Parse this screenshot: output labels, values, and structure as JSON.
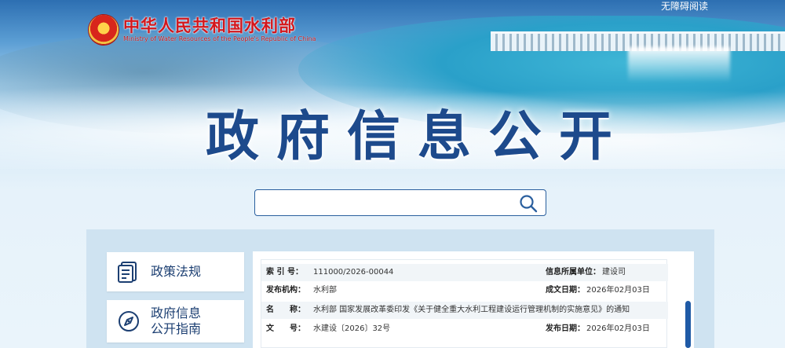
{
  "header": {
    "accessible_label": "无障碍阅读",
    "logo_cn": "中华人民共和国水利部",
    "logo_en": "Ministry of Water Resources of the People's Republic of China",
    "title": "政府信息公开"
  },
  "search": {
    "value": "",
    "placeholder": ""
  },
  "sidebar": {
    "items": [
      {
        "label": "政策法规",
        "icon": "policy-document-icon"
      },
      {
        "label_line1": "政府信息",
        "label_line2": "公开指南",
        "icon": "compass-icon"
      }
    ]
  },
  "info": {
    "index_label": "索 引 号：",
    "index_value": "111000/2026-00044",
    "unit_label": "信息所属单位：",
    "unit_value": "建设司",
    "issuer_label": "发布机构：",
    "issuer_value": "水利部",
    "created_label": "成文日期：",
    "created_value": "2026年02月03日",
    "name_label": "名　　称：",
    "name_value": "水利部 国家发展改革委印发《关于健全重大水利工程建设运行管理机制的实施意见》的通知",
    "doc_label": "文　　号：",
    "doc_value": "水建设〔2026〕32号",
    "published_label": "发布日期：",
    "published_value": "2026年02月03日"
  },
  "colors": {
    "accent": "#1d4a8c",
    "logo_red": "#d3171c",
    "scroll": "#1f5aa6"
  }
}
